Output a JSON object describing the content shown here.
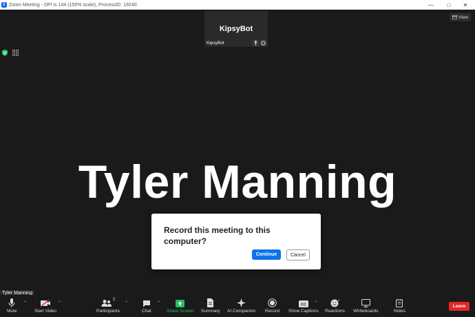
{
  "window": {
    "title": "Zoom Meeting - DPI is 144 (150% scale), ProcessID: 19240"
  },
  "header": {
    "view_label": "View"
  },
  "thumbnail": {
    "display_name": "KipsyBot",
    "label": "KipsyBot"
  },
  "main": {
    "speaker_name": "Tyler Manning"
  },
  "dialog": {
    "message": "Record this meeting to this computer?",
    "continue_label": "Continue",
    "cancel_label": "Cancel"
  },
  "self_view": {
    "label": "Tyler Manning"
  },
  "toolbar": {
    "mute": "Mute",
    "start_video": "Start Video",
    "participants": "Participants",
    "participants_count": "2",
    "chat": "Chat",
    "share_screen": "Share Screen",
    "summary": "Summary",
    "ai_companion": "AI Companion",
    "record": "Record",
    "show_captions": "Show Captions",
    "reactions": "Reactions",
    "whiteboards": "Whiteboards",
    "notes": "Notes",
    "leave": "Leave"
  },
  "colors": {
    "accent": "#0e72ed",
    "share_green": "#25c164",
    "leave_red": "#e02828"
  }
}
